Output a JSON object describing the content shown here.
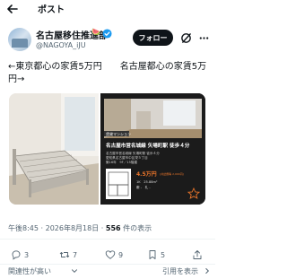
{
  "header": {
    "title": "ポスト"
  },
  "author": {
    "display_name": "名古屋移住推進部",
    "emoji": "🍉",
    "handle": "@NAGOYA_iJU",
    "follow_label": "フォロー"
  },
  "tweet": {
    "lines": [
      "←東京都心の家賃5万円　　名古屋都心の家賃5万",
      "円→"
    ]
  },
  "media": {
    "right": {
      "tag": "賃貸マンション",
      "title": "名古屋市営名城線 矢場町駅 徒歩４分",
      "details": [
        "名古屋市営名城線 矢場町駅 徒歩４分",
        "愛知県名古屋市中区栄５丁目",
        "築16年　9F／15階建"
      ],
      "price": "4.5万円",
      "price_note": "(共益費等 2,000円)",
      "layout": "1K　25.88m²",
      "deposit": "敷 -　礼 -"
    }
  },
  "meta": {
    "time": "午後8:45",
    "date": "2026年8月18日",
    "views_count": "556",
    "views_label": "件の表示",
    "separator": "·"
  },
  "actions": {
    "replies": "3",
    "reposts": "7",
    "likes": "9",
    "bookmarks": "5"
  },
  "footer": {
    "relevance_label": "関連性が高い",
    "quote_label": "引用を表示"
  }
}
